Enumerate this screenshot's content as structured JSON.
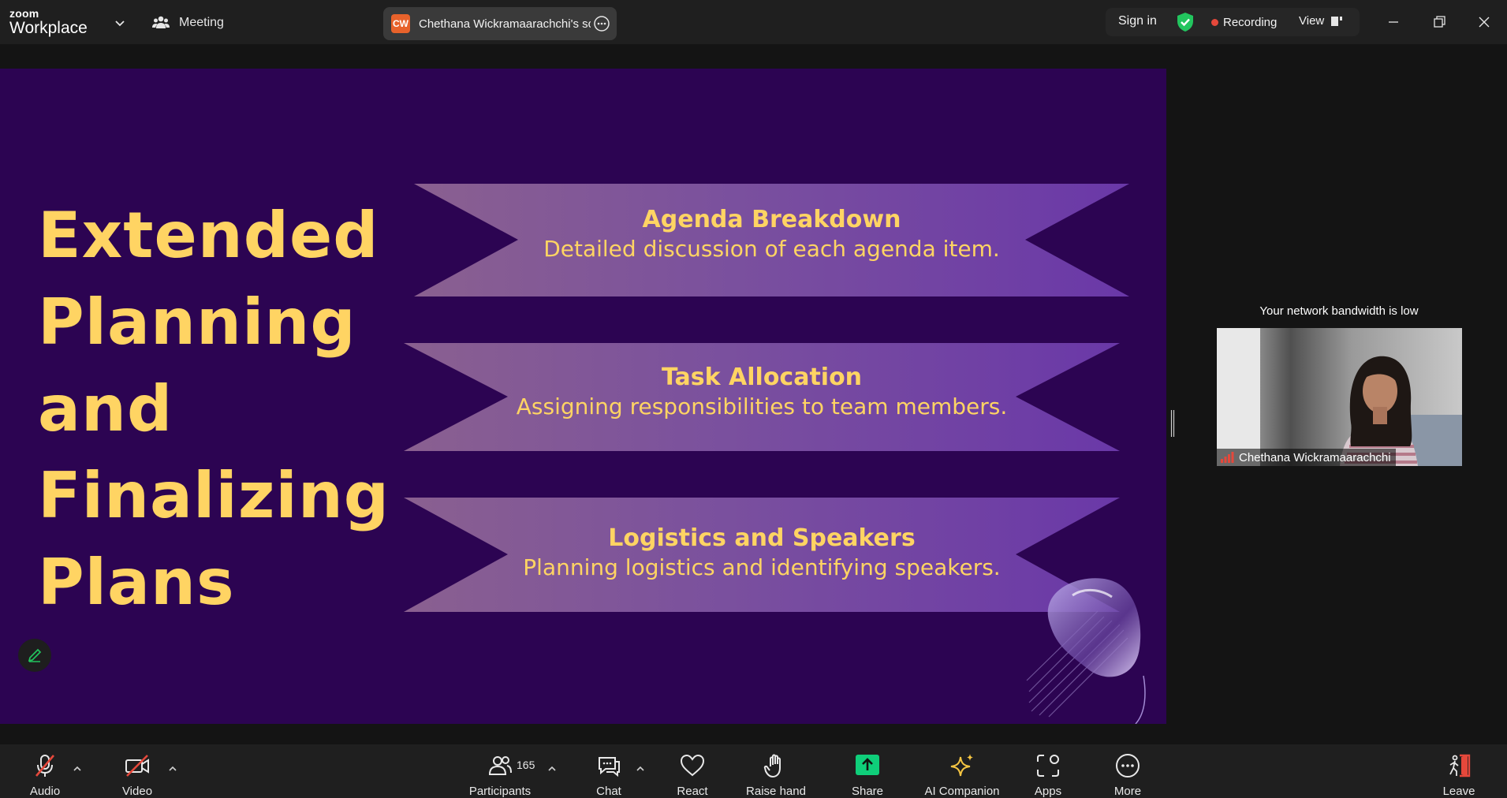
{
  "app": {
    "logo_line1": "zoom",
    "logo_line2": "Workplace",
    "meeting_label": "Meeting",
    "share_tab": {
      "initials": "CW",
      "name": "Chethana Wickramaarachchi's scr"
    },
    "sign_in": "Sign in",
    "recording": "Recording",
    "view": "View"
  },
  "slide": {
    "title_lines": [
      "Extended",
      "Planning",
      "and",
      "Finalizing",
      "Plans"
    ],
    "ribbons": [
      {
        "heading": "Agenda Breakdown",
        "body": "Detailed discussion of each agenda item."
      },
      {
        "heading": "Task Allocation",
        "body": "Assigning responsibilities to team members."
      },
      {
        "heading": "Logistics and Speakers",
        "body": "Planning logistics and identifying speakers."
      }
    ]
  },
  "video": {
    "network_notice": "Your network bandwidth is low",
    "participant_name": "Chethana Wickramaarachchi"
  },
  "toolbar": {
    "audio": "Audio",
    "video": "Video",
    "participants": "Participants",
    "participants_count": "165",
    "chat": "Chat",
    "react": "React",
    "raise_hand": "Raise hand",
    "share": "Share",
    "ai_companion": "AI Companion",
    "apps": "Apps",
    "more": "More",
    "leave": "Leave"
  },
  "colors": {
    "slide_bg": "#2c0452",
    "slide_text": "#ffd463",
    "ribbon_fill": "#7a4ea0",
    "share_green": "#0fce7a",
    "recording_red": "#e5483b",
    "shield_green": "#22c55e",
    "ai_gold": "#f5c542"
  }
}
